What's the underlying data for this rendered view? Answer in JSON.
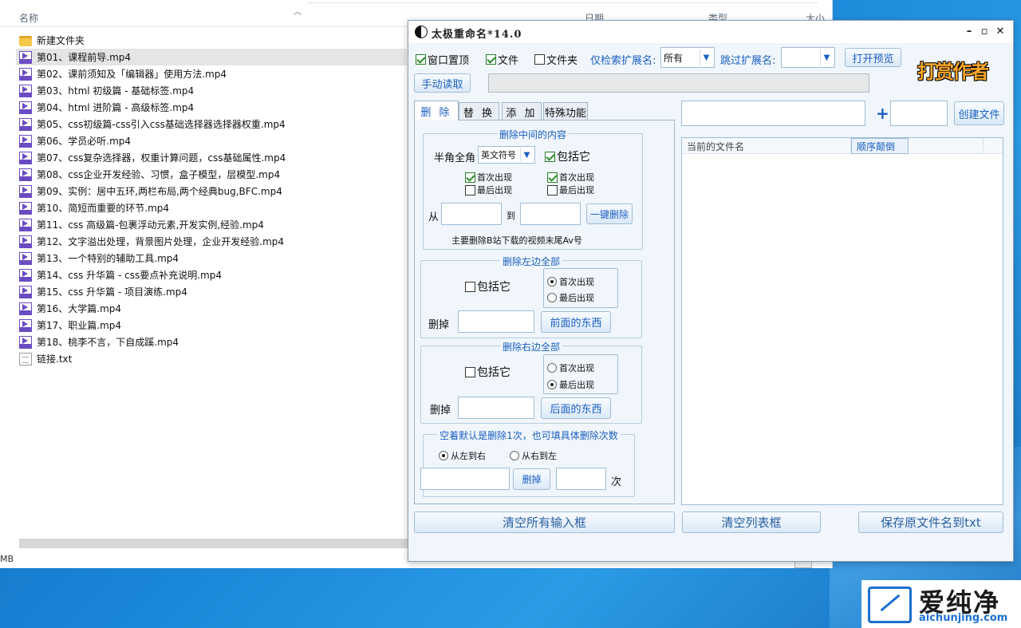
{
  "explorer": {
    "columns": {
      "name": "名称",
      "date": "日期",
      "type": "类型",
      "size": "大小"
    },
    "files": [
      {
        "name": "新建文件夹",
        "icon": "folder-icon"
      },
      {
        "name": "第01、课程前导.mp4",
        "icon": "mp4-icon",
        "selected": true
      },
      {
        "name": "第02、课前须知及「编辑器」使用方法.mp4",
        "icon": "mp4-icon"
      },
      {
        "name": "第03、html 初级篇 - 基础标签.mp4",
        "icon": "mp4-icon"
      },
      {
        "name": "第04、html 进阶篇 - 高级标签.mp4",
        "icon": "mp4-icon"
      },
      {
        "name": "第05、css初级篇-css引入css基础选择器选择器权重.mp4",
        "icon": "mp4-icon"
      },
      {
        "name": "第06、学员必听.mp4",
        "icon": "mp4-icon"
      },
      {
        "name": "第07、css复杂选择器，权重计算问题，css基础属性.mp4",
        "icon": "mp4-icon"
      },
      {
        "name": "第08、css企业开发经验、习惯，盒子模型，层模型.mp4",
        "icon": "mp4-icon"
      },
      {
        "name": "第09、实例：居中五环,两栏布局,两个经典bug,BFC.mp4",
        "icon": "mp4-icon"
      },
      {
        "name": "第10、简短而重要的环节.mp4",
        "icon": "mp4-icon"
      },
      {
        "name": "第11、css 高级篇-包裹浮动元素,开发实例,经验.mp4",
        "icon": "mp4-icon"
      },
      {
        "name": "第12、文字溢出处理，背景图片处理，企业开发经验.mp4",
        "icon": "mp4-icon"
      },
      {
        "name": "第13、一个特别的辅助工具.mp4",
        "icon": "mp4-icon"
      },
      {
        "name": "第14、css 升华篇 - css要点补充说明.mp4",
        "icon": "mp4-icon"
      },
      {
        "name": "第15、css 升华篇 - 项目演练.mp4",
        "icon": "mp4-icon"
      },
      {
        "name": "第16、大学篇.mp4",
        "icon": "mp4-icon"
      },
      {
        "name": "第17、职业篇.mp4",
        "icon": "mp4-icon"
      },
      {
        "name": "第18、桃李不言，下自成蹊.mp4",
        "icon": "mp4-icon"
      },
      {
        "name": "链接.txt",
        "icon": "txt-icon"
      }
    ],
    "status": "MB"
  },
  "app": {
    "title": "太极重命名*14.0",
    "window_controls": {
      "minimize": "–",
      "maximize": "▫",
      "close": "✕"
    },
    "options": {
      "topmost": "窗口置顶",
      "file": "文件",
      "folder": "文件夹",
      "search_ext_label": "仅检索扩展名:",
      "search_ext_value": "所有",
      "skip_ext_label": "跳过扩展名:",
      "skip_ext_value": "",
      "open_preview": "打开预览"
    },
    "manual_read": "手动读取",
    "donate": "打赏作者",
    "tabs": [
      "删 除",
      "替 换",
      "添 加",
      "特殊功能"
    ],
    "delete_middle": {
      "title": "删除中间的内容",
      "width_label": "半角全角",
      "width_value": "英文符号",
      "include": "包括它",
      "first_left": "首次出现",
      "last_left": "最后出现",
      "first_right": "首次出现",
      "last_right": "最后出现",
      "from": "从",
      "to": "到",
      "one_click": "一键删除",
      "hint": "主要删除B站下载的视频末尾Av号"
    },
    "delete_left": {
      "title": "删除左边全部",
      "include": "包括它",
      "first": "首次出现",
      "last": "最后出现",
      "remove_label": "删掉",
      "button": "前面的东西"
    },
    "delete_right": {
      "title": "删除右边全部",
      "include": "包括它",
      "first": "首次出现",
      "last": "最后出现",
      "remove_label": "删掉",
      "button": "后面的东西"
    },
    "delete_count": {
      "title": "空着默认是删除1次，也可填具体删除次数",
      "left_to_right": "从左到右",
      "right_to_left": "从右到左",
      "delete_button": "删掉",
      "times": "次"
    },
    "create": {
      "plus": "+",
      "button": "创建文件"
    },
    "list": {
      "col_current": "当前的文件名",
      "col_reverse": "顺序颠倒"
    },
    "bottom": {
      "clear_inputs": "清空所有输入框",
      "clear_list": "清空列表框",
      "save_names": "保存原文件名到txt"
    }
  },
  "watermark": {
    "brand_cn": "爱纯净",
    "brand_en": "aichunjing.com"
  }
}
